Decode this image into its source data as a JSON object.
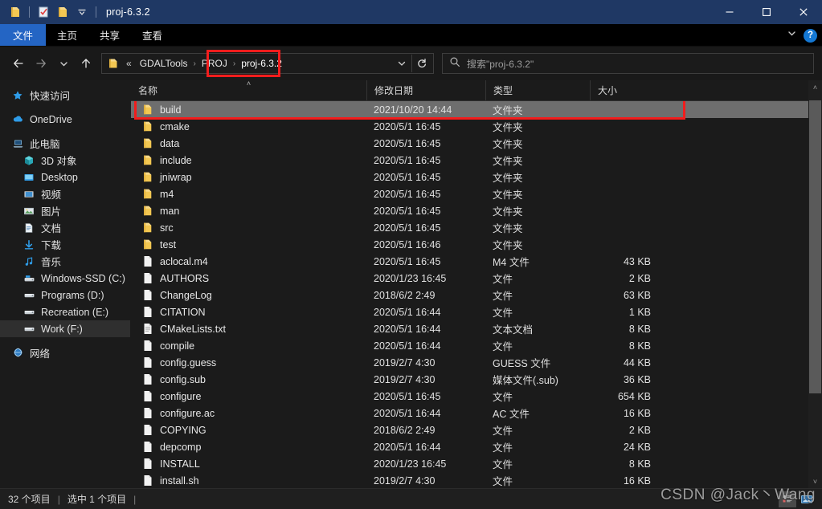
{
  "window": {
    "title": "proj-6.3.2",
    "quick_access": [
      {
        "name": "pin-to-quick-access-icon",
        "glyph": "folder"
      },
      {
        "name": "properties-icon",
        "glyph": "checkmark-doc"
      },
      {
        "name": "new-folder-icon",
        "glyph": "folder"
      },
      {
        "name": "customize-quick-access-toolbar-icon",
        "glyph": "chevron-down"
      }
    ],
    "controls": {
      "minimize": "—",
      "maximize": "□",
      "close": "✕"
    }
  },
  "ribbon": {
    "tabs": [
      {
        "label": "文件",
        "active": true
      },
      {
        "label": "主页",
        "active": false
      },
      {
        "label": "共享",
        "active": false
      },
      {
        "label": "查看",
        "active": false
      }
    ],
    "collapse_label": "⌄",
    "help_label": "?"
  },
  "addressbar": {
    "back_label": "←",
    "forward_label": "→",
    "recent_label": "⌄",
    "up_label": "↑",
    "overflow_label": "«",
    "crumbs": [
      {
        "label": "GDALTools",
        "current": false
      },
      {
        "label": "PROJ",
        "current": false
      },
      {
        "label": "proj-6.3.2",
        "current": true
      }
    ],
    "crumb_separator": "›",
    "dropdown_label": "⌄",
    "refresh_label": "↻"
  },
  "search": {
    "placeholder": "搜索\"proj-6.3.2\"",
    "icon": "search-icon"
  },
  "sidebar": {
    "items": [
      {
        "label": "快速访问",
        "icon": "star-icon",
        "indent": false,
        "selected": false,
        "gap_before": false
      },
      {
        "label": "OneDrive",
        "icon": "cloud-icon",
        "indent": false,
        "selected": false,
        "gap_before": true
      },
      {
        "label": "此电脑",
        "icon": "computer-icon",
        "indent": false,
        "selected": false,
        "gap_before": true
      },
      {
        "label": "3D 对象",
        "icon": "cube-icon",
        "indent": true,
        "selected": false,
        "gap_before": false
      },
      {
        "label": "Desktop",
        "icon": "desktop-icon",
        "indent": true,
        "selected": false,
        "gap_before": false
      },
      {
        "label": "视频",
        "icon": "video-icon",
        "indent": true,
        "selected": false,
        "gap_before": false
      },
      {
        "label": "图片",
        "icon": "picture-icon",
        "indent": true,
        "selected": false,
        "gap_before": false
      },
      {
        "label": "文档",
        "icon": "document-icon",
        "indent": true,
        "selected": false,
        "gap_before": false
      },
      {
        "label": "下载",
        "icon": "download-icon",
        "indent": true,
        "selected": false,
        "gap_before": false
      },
      {
        "label": "音乐",
        "icon": "music-icon",
        "indent": true,
        "selected": false,
        "gap_before": false
      },
      {
        "label": "Windows-SSD (C:)",
        "icon": "system-drive-icon",
        "indent": true,
        "selected": false,
        "gap_before": false
      },
      {
        "label": "Programs (D:)",
        "icon": "drive-icon",
        "indent": true,
        "selected": false,
        "gap_before": false
      },
      {
        "label": "Recreation (E:)",
        "icon": "drive-icon",
        "indent": true,
        "selected": false,
        "gap_before": false
      },
      {
        "label": "Work (F:)",
        "icon": "drive-icon",
        "indent": true,
        "selected": true,
        "gap_before": false
      },
      {
        "label": "网络",
        "icon": "network-icon",
        "indent": false,
        "selected": false,
        "gap_before": true
      }
    ]
  },
  "filelist": {
    "columns": [
      {
        "label": "名称",
        "sorted": true,
        "sort_caret": "˄"
      },
      {
        "label": "修改日期",
        "sorted": false
      },
      {
        "label": "类型",
        "sorted": false
      },
      {
        "label": "大小",
        "sorted": false
      }
    ],
    "rows": [
      {
        "name": "build",
        "date": "2021/10/20 14:44",
        "type": "文件夹",
        "size": "",
        "kind": "folder",
        "selected": true,
        "annotated": true
      },
      {
        "name": "cmake",
        "date": "2020/5/1 16:45",
        "type": "文件夹",
        "size": "",
        "kind": "folder",
        "selected": false,
        "annotated": false
      },
      {
        "name": "data",
        "date": "2020/5/1 16:45",
        "type": "文件夹",
        "size": "",
        "kind": "folder",
        "selected": false,
        "annotated": false
      },
      {
        "name": "include",
        "date": "2020/5/1 16:45",
        "type": "文件夹",
        "size": "",
        "kind": "folder",
        "selected": false,
        "annotated": false
      },
      {
        "name": "jniwrap",
        "date": "2020/5/1 16:45",
        "type": "文件夹",
        "size": "",
        "kind": "folder",
        "selected": false,
        "annotated": false
      },
      {
        "name": "m4",
        "date": "2020/5/1 16:45",
        "type": "文件夹",
        "size": "",
        "kind": "folder",
        "selected": false,
        "annotated": false
      },
      {
        "name": "man",
        "date": "2020/5/1 16:45",
        "type": "文件夹",
        "size": "",
        "kind": "folder",
        "selected": false,
        "annotated": false
      },
      {
        "name": "src",
        "date": "2020/5/1 16:45",
        "type": "文件夹",
        "size": "",
        "kind": "folder",
        "selected": false,
        "annotated": false
      },
      {
        "name": "test",
        "date": "2020/5/1 16:46",
        "type": "文件夹",
        "size": "",
        "kind": "folder",
        "selected": false,
        "annotated": false
      },
      {
        "name": "aclocal.m4",
        "date": "2020/5/1 16:45",
        "type": "M4 文件",
        "size": "43 KB",
        "kind": "file",
        "selected": false,
        "annotated": false
      },
      {
        "name": "AUTHORS",
        "date": "2020/1/23 16:45",
        "type": "文件",
        "size": "2 KB",
        "kind": "file",
        "selected": false,
        "annotated": false
      },
      {
        "name": "ChangeLog",
        "date": "2018/6/2 2:49",
        "type": "文件",
        "size": "63 KB",
        "kind": "file",
        "selected": false,
        "annotated": false
      },
      {
        "name": "CITATION",
        "date": "2020/5/1 16:44",
        "type": "文件",
        "size": "1 KB",
        "kind": "file",
        "selected": false,
        "annotated": false
      },
      {
        "name": "CMakeLists.txt",
        "date": "2020/5/1 16:44",
        "type": "文本文档",
        "size": "8 KB",
        "kind": "text",
        "selected": false,
        "annotated": false
      },
      {
        "name": "compile",
        "date": "2020/5/1 16:44",
        "type": "文件",
        "size": "8 KB",
        "kind": "file",
        "selected": false,
        "annotated": false
      },
      {
        "name": "config.guess",
        "date": "2019/2/7 4:30",
        "type": "GUESS 文件",
        "size": "44 KB",
        "kind": "file",
        "selected": false,
        "annotated": false
      },
      {
        "name": "config.sub",
        "date": "2019/2/7 4:30",
        "type": "媒体文件(.sub)",
        "size": "36 KB",
        "kind": "file",
        "selected": false,
        "annotated": false
      },
      {
        "name": "configure",
        "date": "2020/5/1 16:45",
        "type": "文件",
        "size": "654 KB",
        "kind": "file",
        "selected": false,
        "annotated": false
      },
      {
        "name": "configure.ac",
        "date": "2020/5/1 16:44",
        "type": "AC 文件",
        "size": "16 KB",
        "kind": "file",
        "selected": false,
        "annotated": false
      },
      {
        "name": "COPYING",
        "date": "2018/6/2 2:49",
        "type": "文件",
        "size": "2 KB",
        "kind": "file",
        "selected": false,
        "annotated": false
      },
      {
        "name": "depcomp",
        "date": "2020/5/1 16:44",
        "type": "文件",
        "size": "24 KB",
        "kind": "file",
        "selected": false,
        "annotated": false
      },
      {
        "name": "INSTALL",
        "date": "2020/1/23 16:45",
        "type": "文件",
        "size": "8 KB",
        "kind": "file",
        "selected": false,
        "annotated": false
      },
      {
        "name": "install.sh",
        "date": "2019/2/7 4:30",
        "type": "文件",
        "size": "16 KB",
        "kind": "file",
        "selected": false,
        "annotated": false
      }
    ]
  },
  "scrollbar": {
    "up_label": "˄",
    "down_label": "˅"
  },
  "statusbar": {
    "item_count": "32 个项目",
    "separator1": "|",
    "selection": "选中 1 个项目",
    "separator2": "|",
    "views": [
      {
        "name": "details-view-button",
        "active": true
      },
      {
        "name": "large-icons-view-button",
        "active": false
      }
    ]
  },
  "watermark": {
    "text": "CSDN @Jack丶Wang"
  },
  "colors": {
    "titlebar": "#1f3864",
    "accent": "#2465c4",
    "annotation": "#f21d1d",
    "selection": "#6e6e6e",
    "folder": "#f5c542",
    "background": "#1b1b1b"
  }
}
